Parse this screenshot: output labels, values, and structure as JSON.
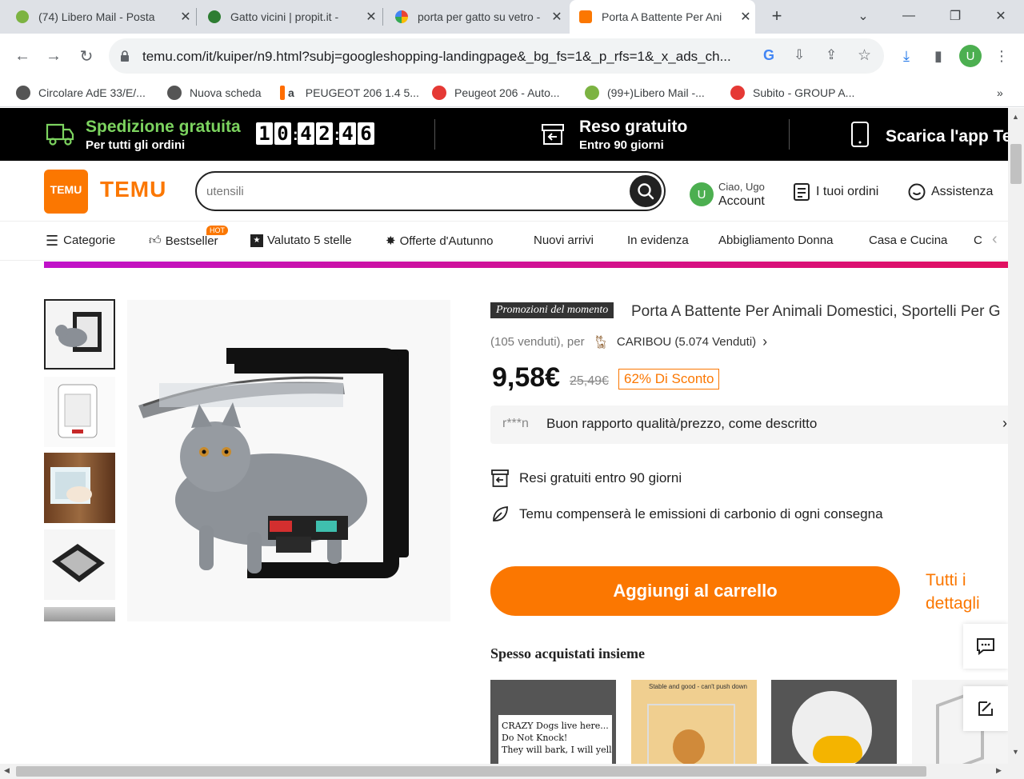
{
  "browser": {
    "tabs": [
      {
        "label": "(74) Libero Mail - Posta",
        "color": "#7cb342"
      },
      {
        "label": "Gatto vicini | propit.it - ",
        "color": "#2e7d32"
      },
      {
        "label": "porta per gatto su vetro -",
        "color": "#4285f4"
      },
      {
        "label": "Porta A Battente Per Ani",
        "color": "#fb7701"
      }
    ],
    "url": "temu.com/it/kuiper/n9.html?subj=googleshopping-landingpage&_bg_fs=1&_p_rfs=1&_x_ads_ch...",
    "profile_initial": "U",
    "bookmarks": [
      {
        "label": "Circolare AdE 33/E/...",
        "color": "#555555"
      },
      {
        "label": "Nuova scheda",
        "color": "#555555"
      },
      {
        "label": "PEUGEOT 206 1.4 5...",
        "color": "#ff6d00"
      },
      {
        "label": "Peugeot 206 - Auto...",
        "color": "#e53935"
      },
      {
        "label": "(99+)Libero Mail -...",
        "color": "#7cb342"
      },
      {
        "label": "Subito - GROUP A...",
        "color": "#e53935"
      }
    ],
    "more_bookmarks": "»"
  },
  "promo": {
    "shipping_title": "Spedizione gratuita",
    "shipping_sub": "Per tutti gli ordini",
    "timer": [
      "1",
      "0",
      "4",
      "2",
      "4",
      "6"
    ],
    "returns_title": "Reso gratuito",
    "returns_sub": "Entro 90 giorni",
    "app_title": "Scarica l'app Te"
  },
  "header": {
    "logo_small": "TEMU",
    "logo_word": "TEMU",
    "search_value": "utensili",
    "account_greeting": "Ciao, Ugo",
    "account_label": "Account",
    "avatar_initial": "U",
    "orders_label": "I tuoi ordini",
    "support_label": "Assistenza"
  },
  "nav": {
    "categories": "Categorie",
    "items": [
      "Bestseller",
      "Valutato 5 stelle",
      "Offerte d'Autunno",
      "Nuovi arrivi",
      "In evidenza",
      "Abbigliamento Donna",
      "Casa e Cucina",
      "C"
    ],
    "hot_badge": "HOT"
  },
  "product": {
    "promo_tag": "Promozioni del momento",
    "title": "Porta A Battente Per Animali Domestici, Sportelli Per G",
    "sold": "(105 venduti), per",
    "seller": "CARIBOU (5.074 Venduti)",
    "price": "9,58€",
    "old_price": "25,49€",
    "discount": "62% Di Sconto",
    "review_user": "r***n",
    "review_text": "Buon rapporto qualità/prezzo, come descritto",
    "feature_returns": "Resi gratuiti entro 90 giorni",
    "feature_carbon": "Temu compenserà le emissioni di carbonio di ogni consegna",
    "add_to_cart": "Aggiungi al carrello",
    "details": "Tutti i dettagli",
    "bought_together_title": "Spesso acquistati insieme",
    "sign_line1": "CRAZY Dogs live here...",
    "sign_line2": "Do Not Knock!",
    "sign_line3": "They will bark, I will yell.",
    "bought2_caption": "Stable and good - can't push down"
  },
  "colors": {
    "brand": "#fb7701",
    "promo_green": "#7cd35f"
  }
}
